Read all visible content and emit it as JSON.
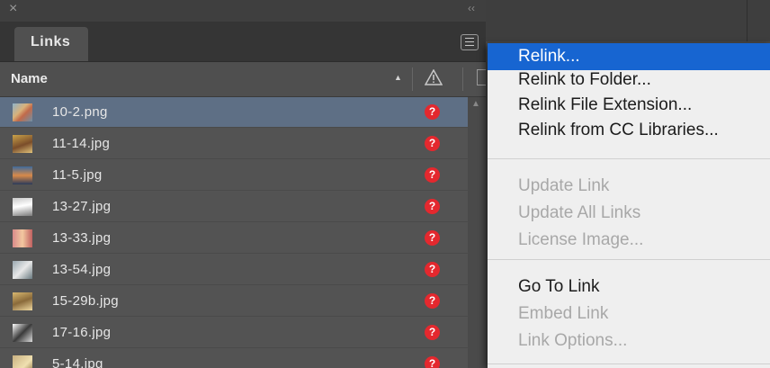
{
  "panel": {
    "tab_title": "Links",
    "close_glyph": "×",
    "collapse_glyph": "‹‹",
    "menu_icon": "hamburger-icon"
  },
  "columns": {
    "name": "Name",
    "sort_glyph": "▲",
    "status_icon": "warning-triangle-icon",
    "page_icon": "page-icon"
  },
  "rows": [
    {
      "name": "10-2.png",
      "status": "?",
      "selected": true
    },
    {
      "name": "11-14.jpg",
      "status": "?"
    },
    {
      "name": "11-5.jpg",
      "status": "?"
    },
    {
      "name": "13-27.jpg",
      "status": "?"
    },
    {
      "name": "13-33.jpg",
      "status": "?"
    },
    {
      "name": "13-54.jpg",
      "status": "?"
    },
    {
      "name": "15-29b.jpg",
      "status": "?"
    },
    {
      "name": "17-16.jpg",
      "status": "?"
    },
    {
      "name": "5-14.jpg",
      "status": "?"
    }
  ],
  "context_menu": {
    "items": [
      {
        "label": "Relink...",
        "state": "highlighted"
      },
      {
        "label": "Relink to Folder...",
        "state": "enabled"
      },
      {
        "label": "Relink File Extension...",
        "state": "enabled"
      },
      {
        "label": "Relink from CC Libraries...",
        "state": "enabled"
      },
      {
        "label": "Update Link",
        "state": "disabled"
      },
      {
        "label": "Update All Links",
        "state": "disabled"
      },
      {
        "label": "License Image...",
        "state": "disabled"
      },
      {
        "label": "Go To Link",
        "state": "enabled"
      },
      {
        "label": "Embed Link",
        "state": "disabled"
      },
      {
        "label": "Link Options...",
        "state": "disabled"
      }
    ]
  },
  "colors": {
    "selection": "#5e6f85",
    "menu_highlight": "#1765d1",
    "missing_badge": "#e4282e"
  }
}
